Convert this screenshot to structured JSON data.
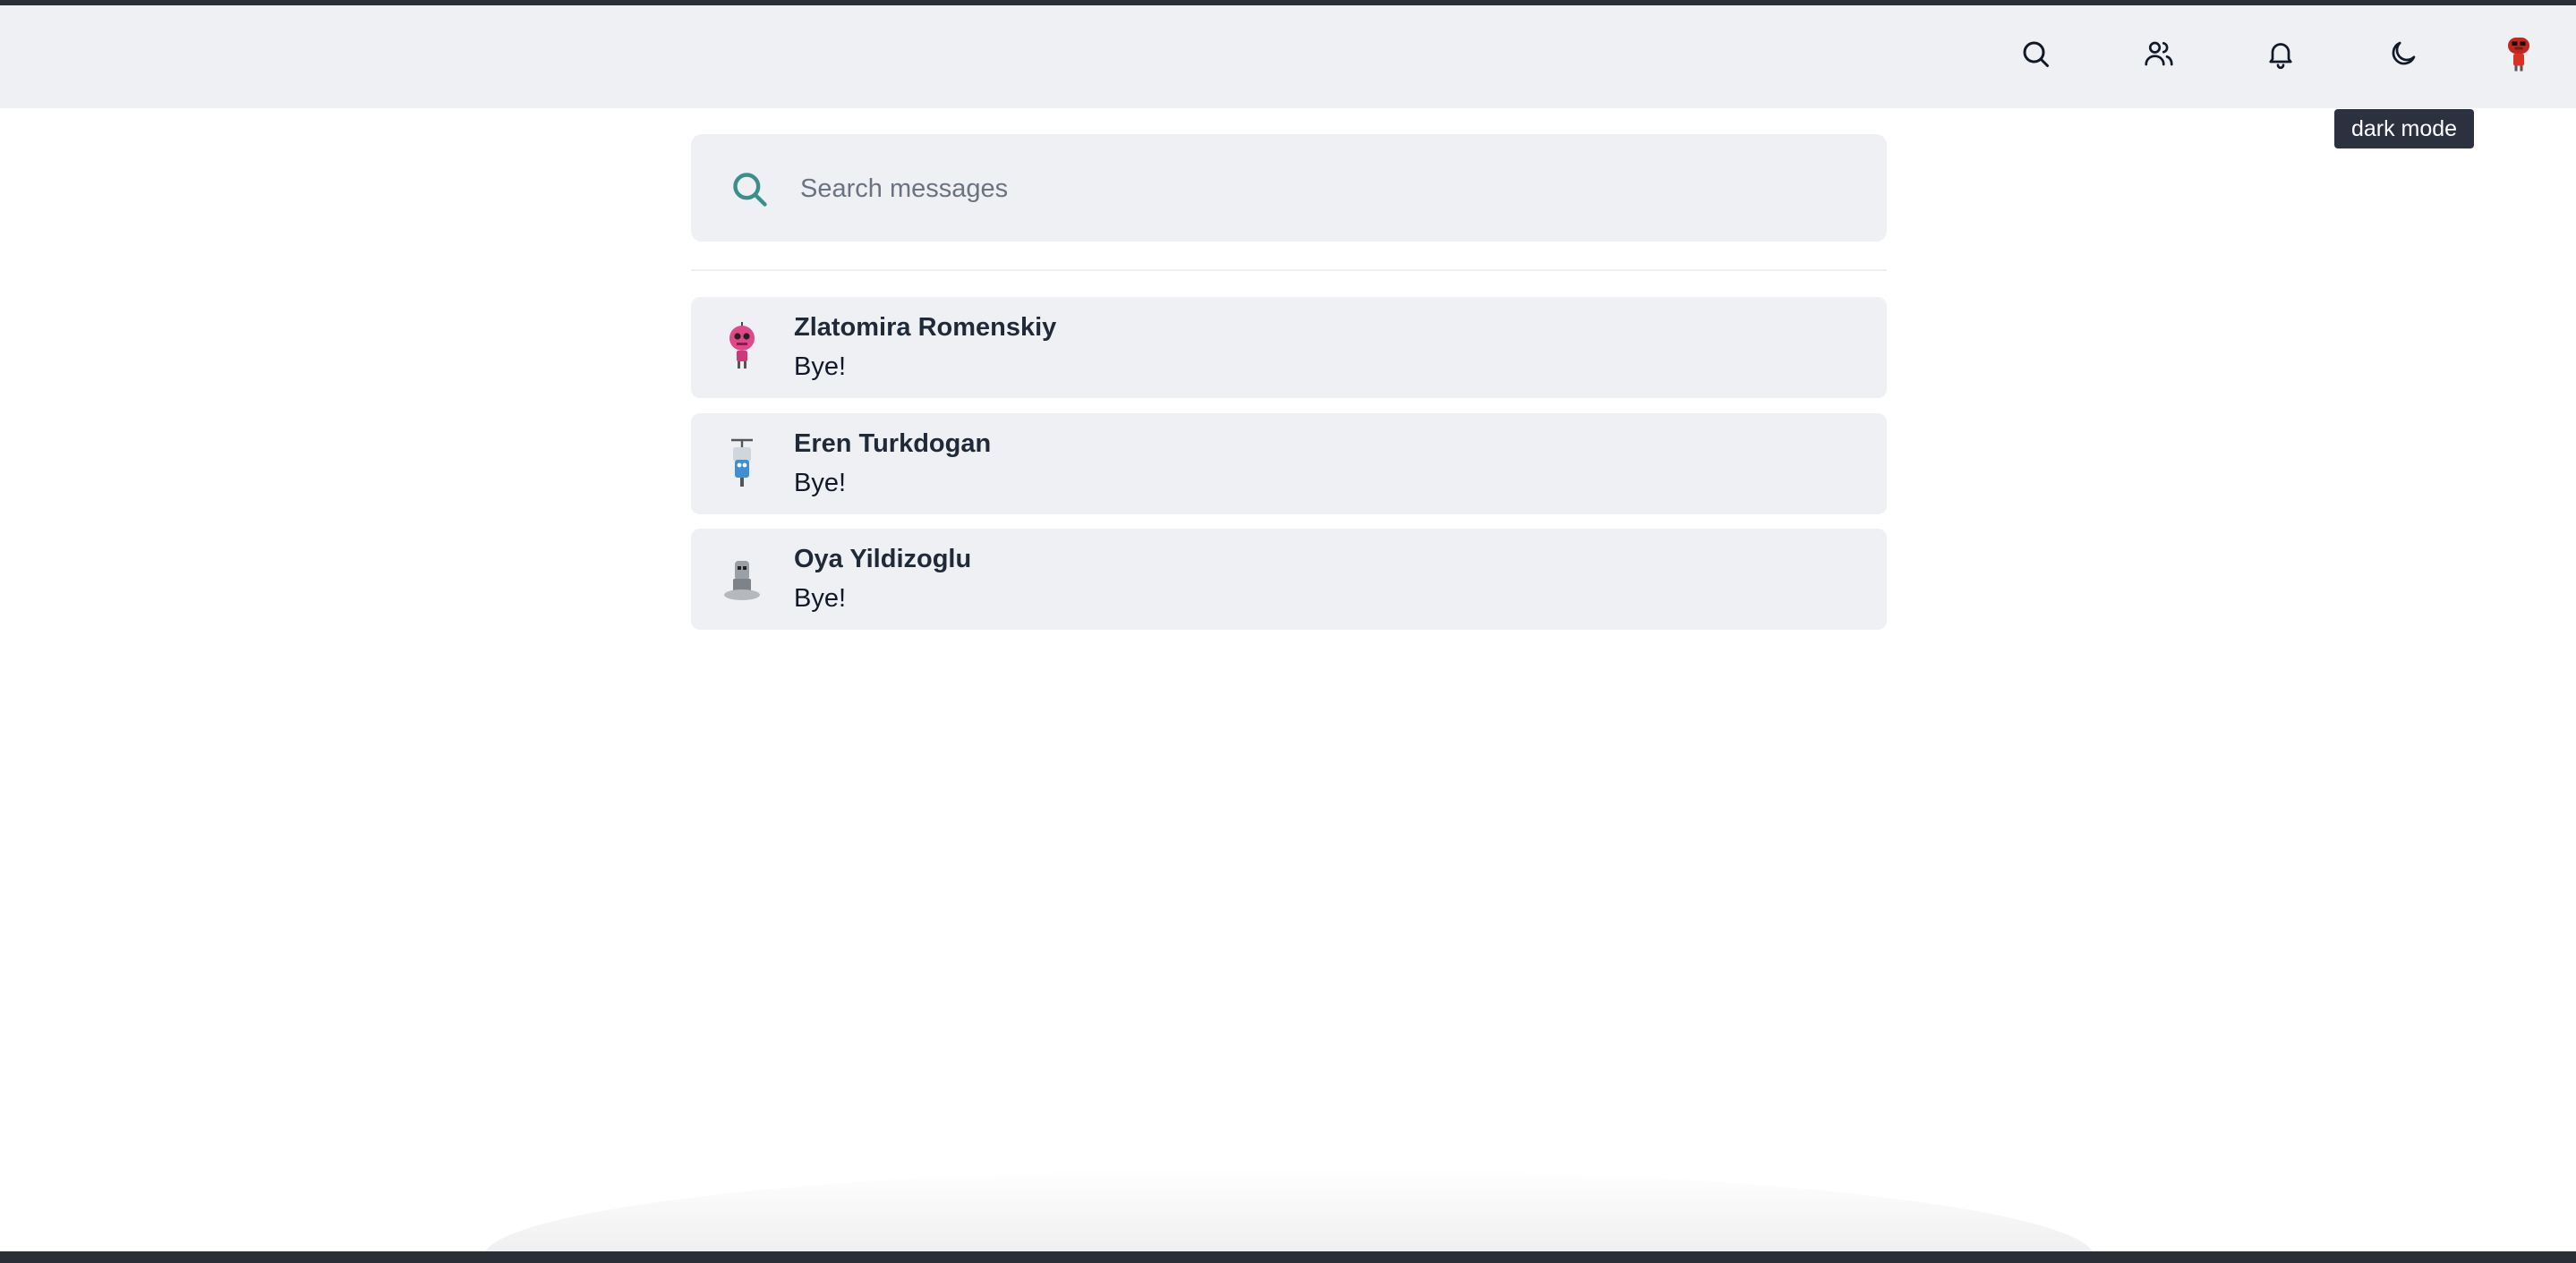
{
  "header": {
    "icons": {
      "search": "search-icon",
      "contacts": "users-icon",
      "notifications": "bell-icon",
      "theme": "moon-icon",
      "profile": "avatar"
    },
    "tooltip": "dark mode"
  },
  "search": {
    "placeholder": "Search messages",
    "value": ""
  },
  "conversations": [
    {
      "name": "Zlatomira Romenskiy",
      "last_message": "Bye!",
      "avatar": "pink-robot-avatar"
    },
    {
      "name": "Eren Turkdogan",
      "last_message": "Bye!",
      "avatar": "blue-robot-avatar"
    },
    {
      "name": "Oya Yildizoglu",
      "last_message": "Bye!",
      "avatar": "gray-robot-avatar"
    }
  ],
  "colors": {
    "topbar_bg": "#eef0f4",
    "card_bg": "#eef0f4",
    "accent_teal": "#3a8f8a",
    "tooltip_bg": "#2c3140",
    "window_border": "#2a2e37"
  }
}
